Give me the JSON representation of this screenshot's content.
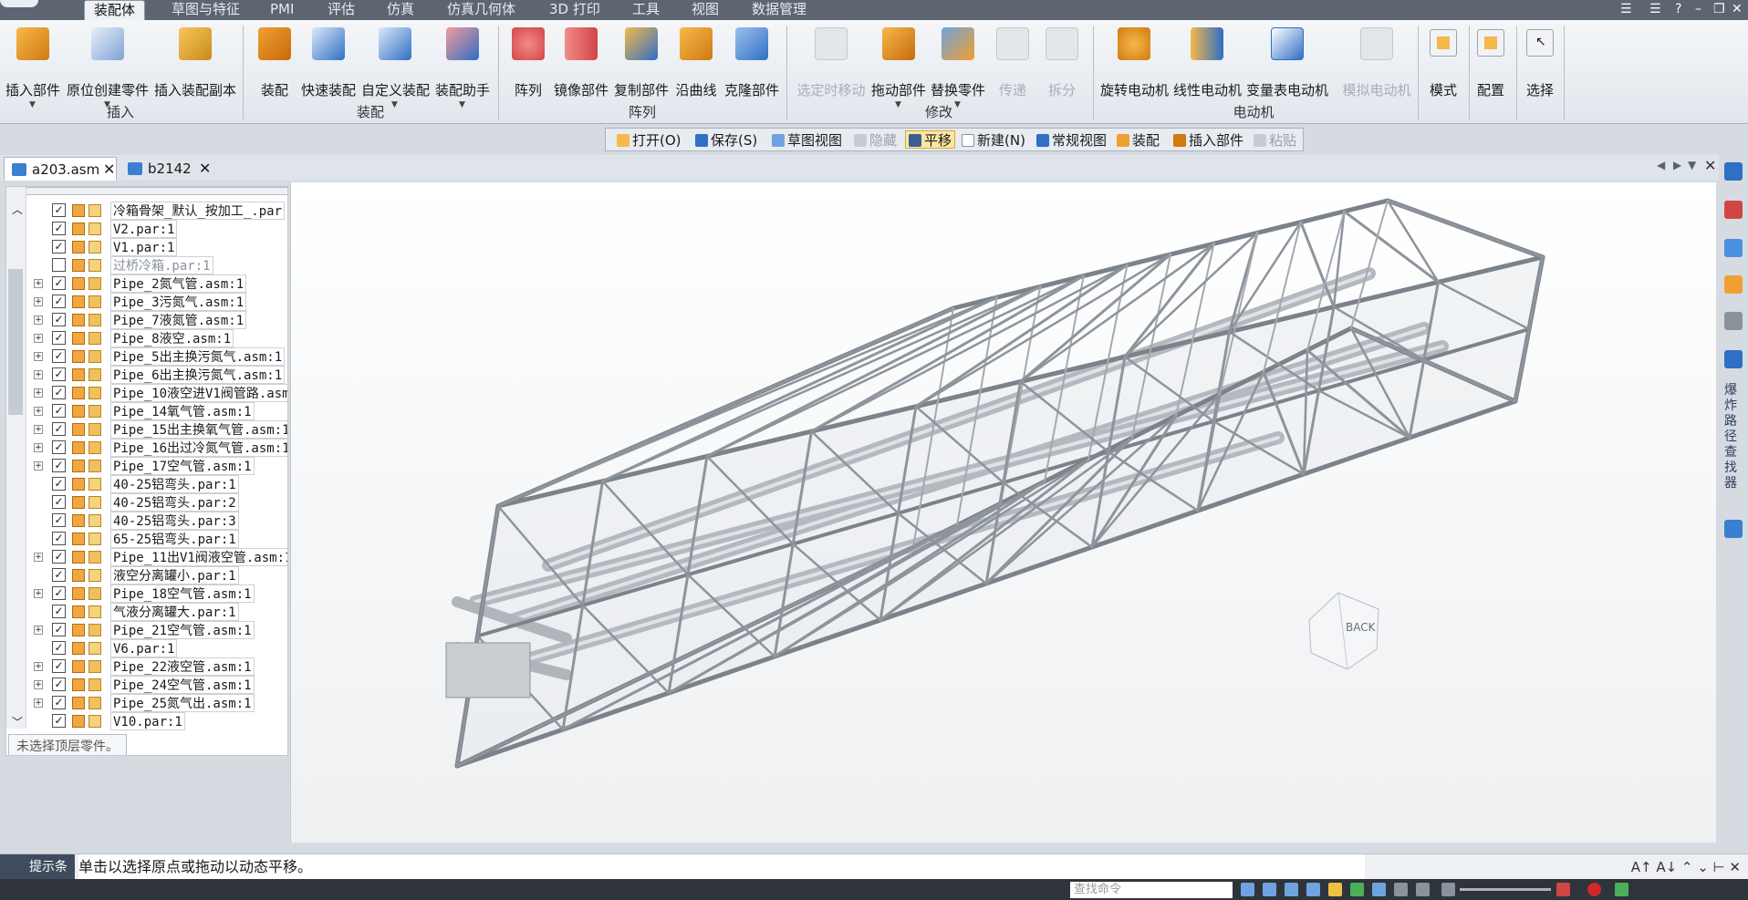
{
  "ribbon_tabs": [
    "装配体",
    "草图与特征",
    "PMI",
    "评估",
    "仿真",
    "仿真几何体",
    "3D 打印",
    "工具",
    "视图",
    "数据管理"
  ],
  "ribbon": {
    "insert_part": "插入部件",
    "create_in_place": "原位创建零件",
    "insert_assembly_copy": "插入装配副本",
    "group_insert": "插入",
    "assemble": "装配",
    "fast_assemble": "快速装配",
    "custom_assemble": "自定义装配",
    "assembly_assistant": "装配助手",
    "group_assemble": "装配",
    "pattern": "阵列",
    "mirror_part": "镜像部件",
    "copy_part": "复制部件",
    "along_curve": "沿曲线",
    "clone_part": "克隆部件",
    "group_pattern": "阵列",
    "select_move": "选定时移动",
    "drag_component": "拖动部件",
    "replace_part": "替换零件",
    "transfer": "传递",
    "disperse": "拆分",
    "group_modify": "修改",
    "rotational_motor": "旋转电动机",
    "linear_motor": "线性电动机",
    "variable_table_motor": "变量表电动机",
    "simulate_motor": "模拟电动机",
    "group_motor": "电动机",
    "mode": "模式",
    "configuration": "配置",
    "select": "选择"
  },
  "quickbar": {
    "open": "打开(O)",
    "save": "保存(S)",
    "sketch_view": "草图视图",
    "hide": "隐藏",
    "pan": "平移",
    "new": "新建(N)",
    "normal_view": "常规视图",
    "assemble": "装配",
    "insert_part": "插入部件",
    "paste": "粘贴"
  },
  "documents": [
    {
      "name": "a203.asm",
      "active": true
    },
    {
      "name": "b2142",
      "active": false
    }
  ],
  "tree": [
    {
      "name": "冷箱骨架_默认_按加工_.par",
      "checked": true,
      "expandable": false,
      "type": "part"
    },
    {
      "name": "V2.par:1",
      "checked": true,
      "expandable": false,
      "type": "part"
    },
    {
      "name": "V1.par:1",
      "checked": true,
      "expandable": false,
      "type": "part"
    },
    {
      "name": "过桥冷箱.par:1",
      "checked": false,
      "expandable": false,
      "type": "part"
    },
    {
      "name": "Pipe_2氮气管.asm:1",
      "checked": true,
      "expandable": true,
      "type": "asm"
    },
    {
      "name": "Pipe_3污氮气.asm:1",
      "checked": true,
      "expandable": true,
      "type": "asm"
    },
    {
      "name": "Pipe_7液氮管.asm:1",
      "checked": true,
      "expandable": true,
      "type": "asm"
    },
    {
      "name": "Pipe_8液空.asm:1",
      "checked": true,
      "expandable": true,
      "type": "asm"
    },
    {
      "name": "Pipe_5出主换污氮气.asm:1",
      "checked": true,
      "expandable": true,
      "type": "asm"
    },
    {
      "name": "Pipe_6出主换污氮气.asm:1",
      "checked": true,
      "expandable": true,
      "type": "asm"
    },
    {
      "name": "Pipe_10液空进V1阀管路.asm",
      "checked": true,
      "expandable": true,
      "type": "asm"
    },
    {
      "name": "Pipe_14氧气管.asm:1",
      "checked": true,
      "expandable": true,
      "type": "asm"
    },
    {
      "name": "Pipe_15出主换氧气管.asm:1",
      "checked": true,
      "expandable": true,
      "type": "asm"
    },
    {
      "name": "Pipe_16出过冷氮气管.asm:1",
      "checked": true,
      "expandable": true,
      "type": "asm"
    },
    {
      "name": "Pipe_17空气管.asm:1",
      "checked": true,
      "expandable": true,
      "type": "asm"
    },
    {
      "name": "40-25铝弯头.par:1",
      "checked": true,
      "expandable": false,
      "type": "part"
    },
    {
      "name": "40-25铝弯头.par:2",
      "checked": true,
      "expandable": false,
      "type": "part"
    },
    {
      "name": "40-25铝弯头.par:3",
      "checked": true,
      "expandable": false,
      "type": "part"
    },
    {
      "name": "65-25铝弯头.par:1",
      "checked": true,
      "expandable": false,
      "type": "part"
    },
    {
      "name": "Pipe_11出V1阀液空管.asm:1",
      "checked": true,
      "expandable": true,
      "type": "asm"
    },
    {
      "name": "液空分离罐小.par:1",
      "checked": true,
      "expandable": false,
      "type": "part"
    },
    {
      "name": "Pipe_18空气管.asm:1",
      "checked": true,
      "expandable": true,
      "type": "asm"
    },
    {
      "name": "气液分离罐大.par:1",
      "checked": true,
      "expandable": false,
      "type": "part"
    },
    {
      "name": "Pipe_21空气管.asm:1",
      "checked": true,
      "expandable": true,
      "type": "asm"
    },
    {
      "name": "V6.par:1",
      "checked": true,
      "expandable": false,
      "type": "part"
    },
    {
      "name": "Pipe_22液空管.asm:1",
      "checked": true,
      "expandable": true,
      "type": "asm"
    },
    {
      "name": "Pipe_24空气管.asm:1",
      "checked": true,
      "expandable": true,
      "type": "asm"
    },
    {
      "name": "Pipe_25氮气出.asm:1",
      "checked": true,
      "expandable": true,
      "type": "asm"
    },
    {
      "name": "V10.par:1",
      "checked": true,
      "expandable": false,
      "type": "part"
    }
  ],
  "tree_status": "未选择顶层零件。",
  "right_panel_tab": "爆炸路径查找器",
  "prompt": {
    "label": "提示条",
    "message": "单击以选择原点或拖动以动态平移。"
  },
  "status": {
    "command_search_placeholder": "查找命令"
  },
  "view_cube_label": "BACK",
  "colors": {
    "accent": "#2f6fc4",
    "frame": "#8e949c",
    "ribbon_tab_bar": "#5d6571"
  }
}
